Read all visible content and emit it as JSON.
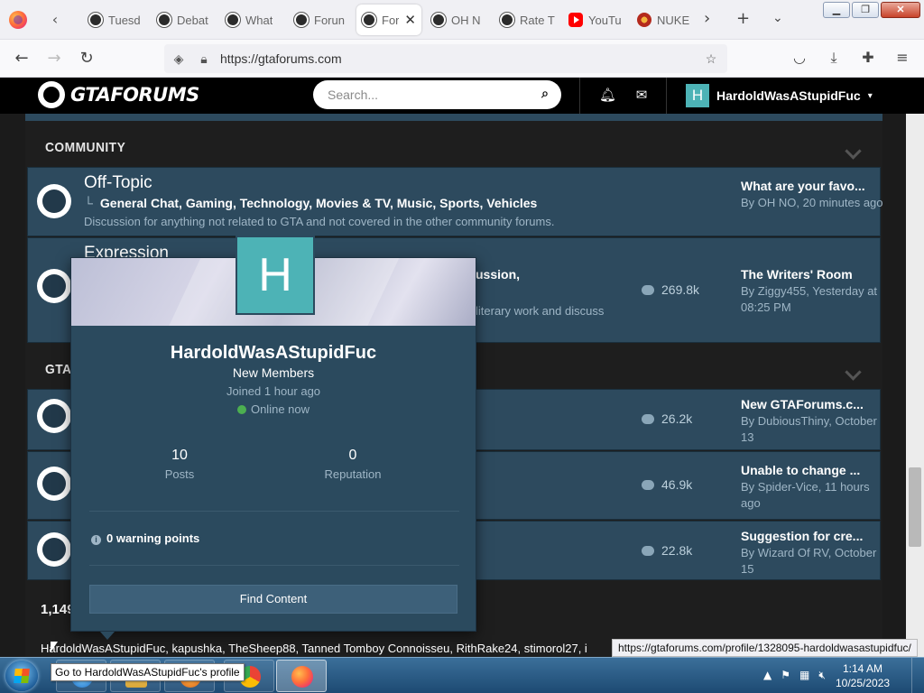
{
  "browser": {
    "tabs": [
      {
        "title": "Tuesd",
        "icon": "gtaf-icon"
      },
      {
        "title": "Debat",
        "icon": "gtaf-icon"
      },
      {
        "title": "What",
        "icon": "gtaf-icon"
      },
      {
        "title": "Forun",
        "icon": "gtaf-icon"
      },
      {
        "title": "For",
        "icon": "gtaf-icon"
      },
      {
        "title": "OH N",
        "icon": "gtaf-icon"
      },
      {
        "title": "Rate T",
        "icon": "gtaf-icon"
      },
      {
        "title": "YouTu",
        "icon": "youtube-icon"
      },
      {
        "title": "NUKE",
        "icon": "nuke-icon"
      }
    ],
    "url": "https://gtaforums.com"
  },
  "site": {
    "logo_text": "GTAFORUMS",
    "search_placeholder": "Search...",
    "username": "HardoldWasAStupidFuc",
    "avatar_letter": "H"
  },
  "categories": [
    {
      "name": "COMMUNITY"
    },
    {
      "name": "GTAN"
    }
  ],
  "forums": [
    {
      "title": "Off-Topic",
      "subforums": "General Chat,   Gaming,   Technology,   Movies & TV,   Music,   Sports,   Vehicles",
      "description": "Discussion for anything not related to GTA and not covered in the other community forums.",
      "last_title": "What are your favo...",
      "last_by": "By OH NO, 20 minutes ago"
    },
    {
      "title": "Expression",
      "subforums": "ussion,",
      "description": "literary work and discuss",
      "posts": "269.8k",
      "last_title": "The Writers' Room",
      "last_by": "By Ziggy455, Yesterday at 08:25 PM"
    },
    {
      "posts": "26.2k",
      "last_title": "New GTAForums.c...",
      "last_by": "By DubiousThiny, October 13"
    },
    {
      "posts": "46.9k",
      "last_title": "Unable to change ...",
      "last_by": "By Spider-Vice, 11 hours ago"
    },
    {
      "posts": "22.8k",
      "last_title": "Suggestion for cre...",
      "last_by": "By Wizard Of RV, October 15"
    }
  ],
  "online": {
    "heading": "1,149",
    "list": "HardoldWasAStupidFuc, kapushka, TheSheep88, Tanned Tomboy Connoisseu, RithRake24, stimorol27, i"
  },
  "hovercard": {
    "name": "HardoldWasAStupidFuc",
    "group": "New Members",
    "joined": "Joined 1 hour ago",
    "online": "Online now",
    "posts_value": "10",
    "posts_label": "Posts",
    "rep_value": "0",
    "rep_label": "Reputation",
    "warning": "0 warning points",
    "button": "Find Content",
    "avatar_letter": "H"
  },
  "status_url": "https://gtaforums.com/profile/1328095-hardoldwasastupidfuc/",
  "tooltip": "Go to HardoldWasAStupidFuc's profile",
  "taskbar": {
    "time": "1:14 AM",
    "date": "10/25/2023"
  },
  "colors": {
    "row_bg": "#2d4a5e",
    "avatar_teal": "#4db3b6",
    "online_green": "#4caf50"
  }
}
